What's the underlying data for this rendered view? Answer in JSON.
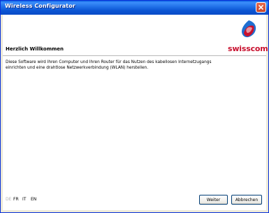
{
  "window": {
    "title": "Wireless Configurator"
  },
  "header": {
    "heading": "Herzlich Willkommen",
    "logo_text": "swisscom"
  },
  "content": {
    "lines": [
      "Diese Software wird Ihren Computer und Ihren Router für das Nutzen des kabellosen Internetzugangs",
      "einrichten und eine drahtlose Netzwerkverbindung (WLAN) herstellen."
    ]
  },
  "footer": {
    "languages": [
      {
        "label": "DE",
        "enabled": false
      },
      {
        "label": "FR",
        "enabled": true
      },
      {
        "label": "IT",
        "enabled": true
      },
      {
        "label": "EN",
        "enabled": true
      }
    ],
    "next_label": "Weiter",
    "cancel_label": "Abbrechen"
  },
  "colors": {
    "brand_red": "#c8102e",
    "brand_blue": "#1f6fd1",
    "titlebar": "#0b55d3"
  },
  "icons": {
    "close": "close-icon",
    "logo": "swisscom-logo-icon"
  }
}
